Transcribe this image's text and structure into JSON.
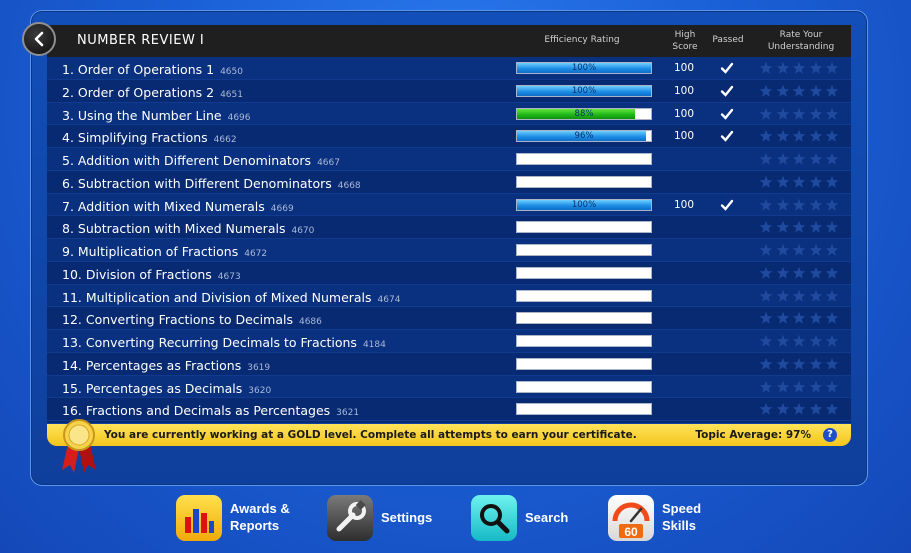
{
  "header": {
    "title": "NUMBER REVIEW I",
    "col_efficiency": "Efficiency Rating",
    "col_high_score": "High Score",
    "col_passed": "Passed",
    "col_rate": "Rate Your Understanding"
  },
  "rows": [
    {
      "label": "1. Order of Operations 1",
      "id": "4650",
      "efficiency": 100,
      "efficiency_text": "100%",
      "bar_color": "blue",
      "score": "100",
      "passed": true
    },
    {
      "label": "2. Order of Operations 2",
      "id": "4651",
      "efficiency": 100,
      "efficiency_text": "100%",
      "bar_color": "blue",
      "score": "100",
      "passed": true
    },
    {
      "label": "3. Using the Number Line",
      "id": "4696",
      "efficiency": 88,
      "efficiency_text": "88%",
      "bar_color": "green",
      "score": "100",
      "passed": true
    },
    {
      "label": "4. Simplifying Fractions",
      "id": "4662",
      "efficiency": 96,
      "efficiency_text": "96%",
      "bar_color": "blue",
      "score": "100",
      "passed": true
    },
    {
      "label": "5. Addition with Different Denominators",
      "id": "4667",
      "efficiency": 0,
      "efficiency_text": "",
      "bar_color": "blue",
      "score": "",
      "passed": false
    },
    {
      "label": "6. Subtraction with Different Denominators",
      "id": "4668",
      "efficiency": 0,
      "efficiency_text": "",
      "bar_color": "blue",
      "score": "",
      "passed": false
    },
    {
      "label": "7. Addition with Mixed Numerals",
      "id": "4669",
      "efficiency": 100,
      "efficiency_text": "100%",
      "bar_color": "blue",
      "score": "100",
      "passed": true
    },
    {
      "label": "8. Subtraction with Mixed Numerals",
      "id": "4670",
      "efficiency": 0,
      "efficiency_text": "",
      "bar_color": "blue",
      "score": "",
      "passed": false
    },
    {
      "label": "9. Multiplication of Fractions",
      "id": "4672",
      "efficiency": 0,
      "efficiency_text": "",
      "bar_color": "blue",
      "score": "",
      "passed": false
    },
    {
      "label": "10. Division of Fractions",
      "id": "4673",
      "efficiency": 0,
      "efficiency_text": "",
      "bar_color": "blue",
      "score": "",
      "passed": false
    },
    {
      "label": "11. Multiplication and Division of Mixed Numerals",
      "id": "4674",
      "efficiency": 0,
      "efficiency_text": "",
      "bar_color": "blue",
      "score": "",
      "passed": false
    },
    {
      "label": "12. Converting Fractions to Decimals",
      "id": "4686",
      "efficiency": 0,
      "efficiency_text": "",
      "bar_color": "blue",
      "score": "",
      "passed": false
    },
    {
      "label": "13. Converting Recurring Decimals to Fractions",
      "id": "4184",
      "efficiency": 0,
      "efficiency_text": "",
      "bar_color": "blue",
      "score": "",
      "passed": false
    },
    {
      "label": "14. Percentages as Fractions",
      "id": "3619",
      "efficiency": 0,
      "efficiency_text": "",
      "bar_color": "blue",
      "score": "",
      "passed": false
    },
    {
      "label": "15. Percentages as Decimals",
      "id": "3620",
      "efficiency": 0,
      "efficiency_text": "",
      "bar_color": "blue",
      "score": "",
      "passed": false
    },
    {
      "label": "16. Fractions and Decimals as Percentages",
      "id": "3621",
      "efficiency": 0,
      "efficiency_text": "",
      "bar_color": "blue",
      "score": "",
      "passed": false
    }
  ],
  "banner": {
    "message": "You are currently working at a GOLD level. Complete all attempts to earn your certificate.",
    "average": "Topic Average: 97%",
    "help": "?"
  },
  "nav": [
    {
      "key": "awards",
      "label_line1": "Awards &",
      "label_line2": "Reports"
    },
    {
      "key": "settings",
      "label_line1": "Settings",
      "label_line2": ""
    },
    {
      "key": "search",
      "label_line1": "Search",
      "label_line2": ""
    },
    {
      "key": "speed",
      "label_line1": "Speed",
      "label_line2": "Skills",
      "badge": "60"
    }
  ],
  "colors": {
    "bar_blue": "#1e8fe6",
    "bar_green": "#20b818",
    "banner_gold": "#f4c51d"
  }
}
